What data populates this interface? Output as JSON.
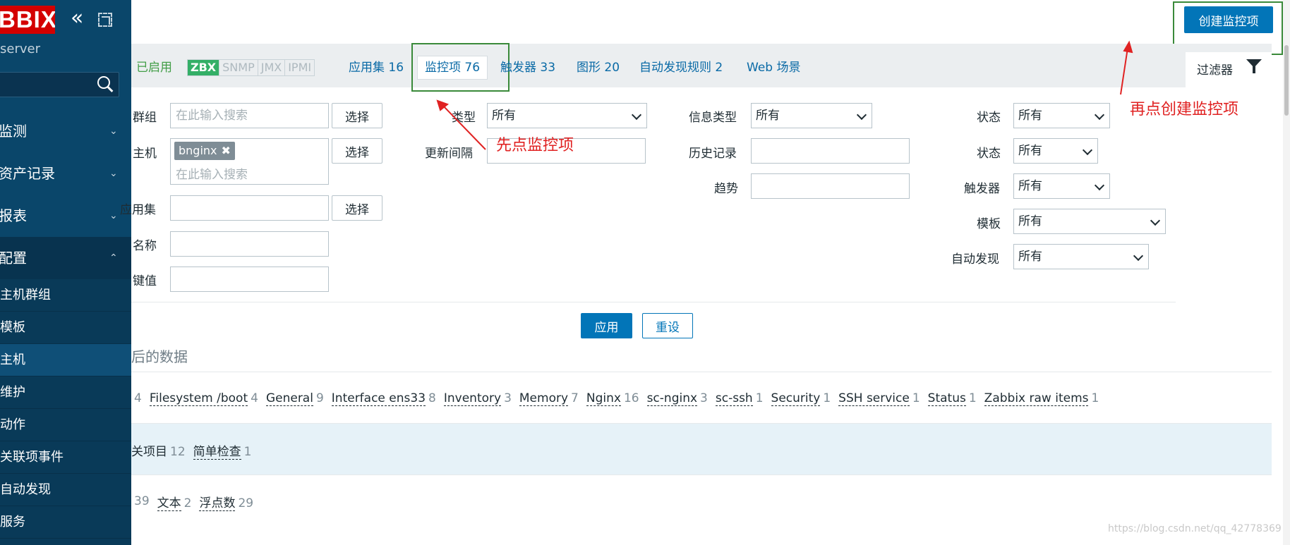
{
  "app": {
    "logo": "BBIX",
    "server": "server"
  },
  "sidebar": {
    "menu": [
      {
        "label": "监测",
        "chevron": "⌄"
      },
      {
        "label": "资产记录",
        "chevron": "⌄"
      },
      {
        "label": "报表",
        "chevron": "⌄"
      },
      {
        "label": "配置",
        "chevron": "⌃"
      }
    ],
    "submenu": [
      "主机群组",
      "模板",
      "主机",
      "维护",
      "动作",
      "关联项事件",
      "自动发现",
      "服务"
    ]
  },
  "header": {
    "create_button": "创建监控项"
  },
  "tabs": {
    "status": "已启用",
    "availability": [
      "ZBX",
      "SNMP",
      "JMX",
      "IPMI"
    ],
    "applications": {
      "label": "应用集",
      "count": "16"
    },
    "items_active": "监控项 76",
    "triggers": {
      "label": "触发器",
      "count": "33"
    },
    "graphs": {
      "label": "图形",
      "count": "20"
    },
    "discovery": {
      "label": "自动发现规则",
      "count": "2"
    },
    "web": "Web 场景",
    "filter": "过滤器"
  },
  "filter": {
    "host_group_label": "群组",
    "host_group_placeholder": "在此输入搜索",
    "host_label": "主机",
    "host_tag": "bnginx",
    "host_tag_remove": "✖",
    "host_placeholder": "在此输入搜索",
    "application_label": "应用集",
    "name_label": "名称",
    "key_label": "键值",
    "select_label": "选择",
    "type_label": "类型",
    "type_value": "所有",
    "update_interval_label": "更新间隔",
    "info_type_label": "信息类型",
    "info_type_value": "所有",
    "history_label": "历史记录",
    "trends_label": "趋势",
    "state_label": "状态",
    "state_value": "所有",
    "status_label": "状态",
    "status_value": "所有",
    "triggers_label": "触发器",
    "triggers_value": "所有",
    "template_label": "模板",
    "template_value": "所有",
    "discovered_label": "自动发现",
    "discovered_value": "所有",
    "apply": "应用",
    "reset": "重设"
  },
  "subfilter": {
    "title": "后的数据",
    "row1": [
      {
        "name": "",
        "count": "4"
      },
      {
        "name": "Filesystem /boot",
        "count": "4"
      },
      {
        "name": "General",
        "count": "9"
      },
      {
        "name": "Interface ens33",
        "count": "8"
      },
      {
        "name": "Inventory",
        "count": "3"
      },
      {
        "name": "Memory",
        "count": "7"
      },
      {
        "name": "Nginx",
        "count": "16"
      },
      {
        "name": "sc-nginx",
        "count": "3"
      },
      {
        "name": "sc-ssh",
        "count": "1"
      },
      {
        "name": "Security",
        "count": "1"
      },
      {
        "name": "SSH service",
        "count": "1"
      },
      {
        "name": "Status",
        "count": "1"
      },
      {
        "name": "Zabbix raw items",
        "count": "1"
      }
    ],
    "row2": [
      {
        "name": "关项目",
        "count": "12"
      },
      {
        "name": "简单检查",
        "count": "1"
      }
    ],
    "row3": [
      {
        "name": "",
        "count": "39"
      },
      {
        "name": "文本",
        "count": "2"
      },
      {
        "name": "浮点数",
        "count": "29"
      }
    ]
  },
  "annotations": {
    "first": "先点监控项",
    "second": "再点创建监控项",
    "color": "#e02222"
  },
  "watermark": "https://blog.csdn.net/qq_42778369"
}
